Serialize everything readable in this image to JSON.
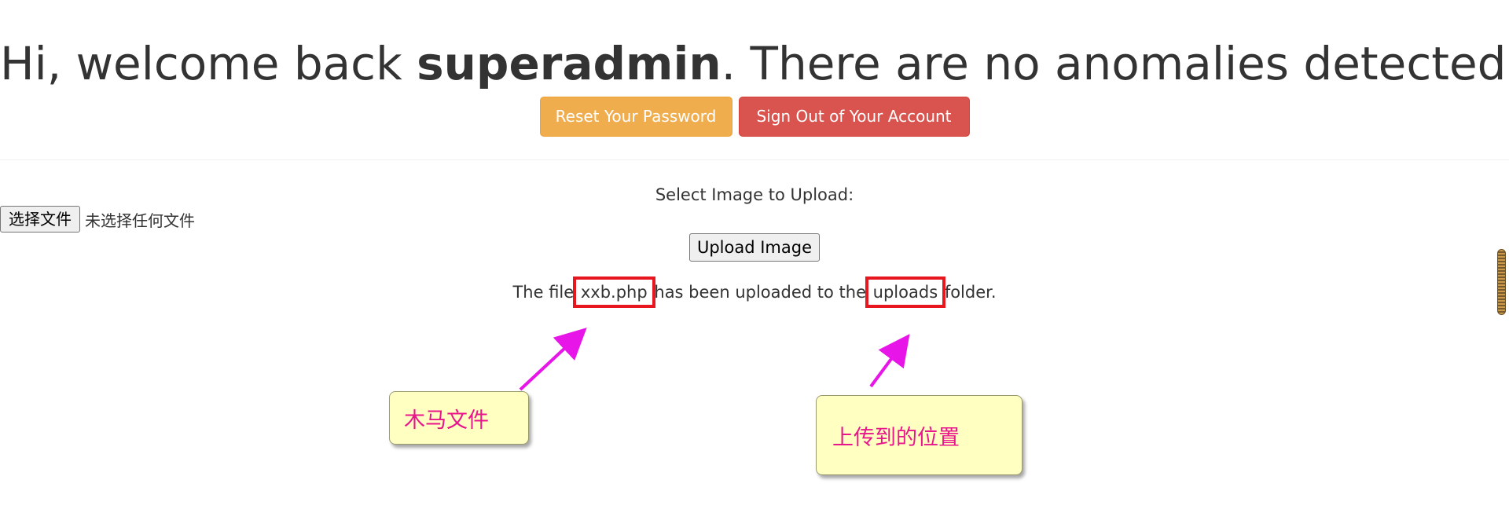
{
  "welcome": {
    "prefix": "Hi, welcome back ",
    "username": "superadmin",
    "suffix": ". There are no anomalies detected."
  },
  "buttons": {
    "reset_password": "Reset Your Password",
    "sign_out": "Sign Out of Your Account"
  },
  "upload_form": {
    "select_label": "Select Image to Upload:",
    "choose_file_button": "选择文件",
    "no_file_chosen": "未选择任何文件",
    "upload_button": "Upload Image"
  },
  "result": {
    "prefix": "The file ",
    "filename": "xxb.php",
    "middle": " has been uploaded to the ",
    "folder": "uploads",
    "suffix": " folder."
  },
  "annotations": {
    "callout_file": "木马文件",
    "callout_location": "上传到的位置",
    "highlight_color": "#e8161f",
    "arrow_color": "#e815e8",
    "callout_text_color": "#e8158c",
    "callout_background": "#ffffc2"
  },
  "colors": {
    "warning": "#f0ad4e",
    "danger": "#d9534f"
  }
}
